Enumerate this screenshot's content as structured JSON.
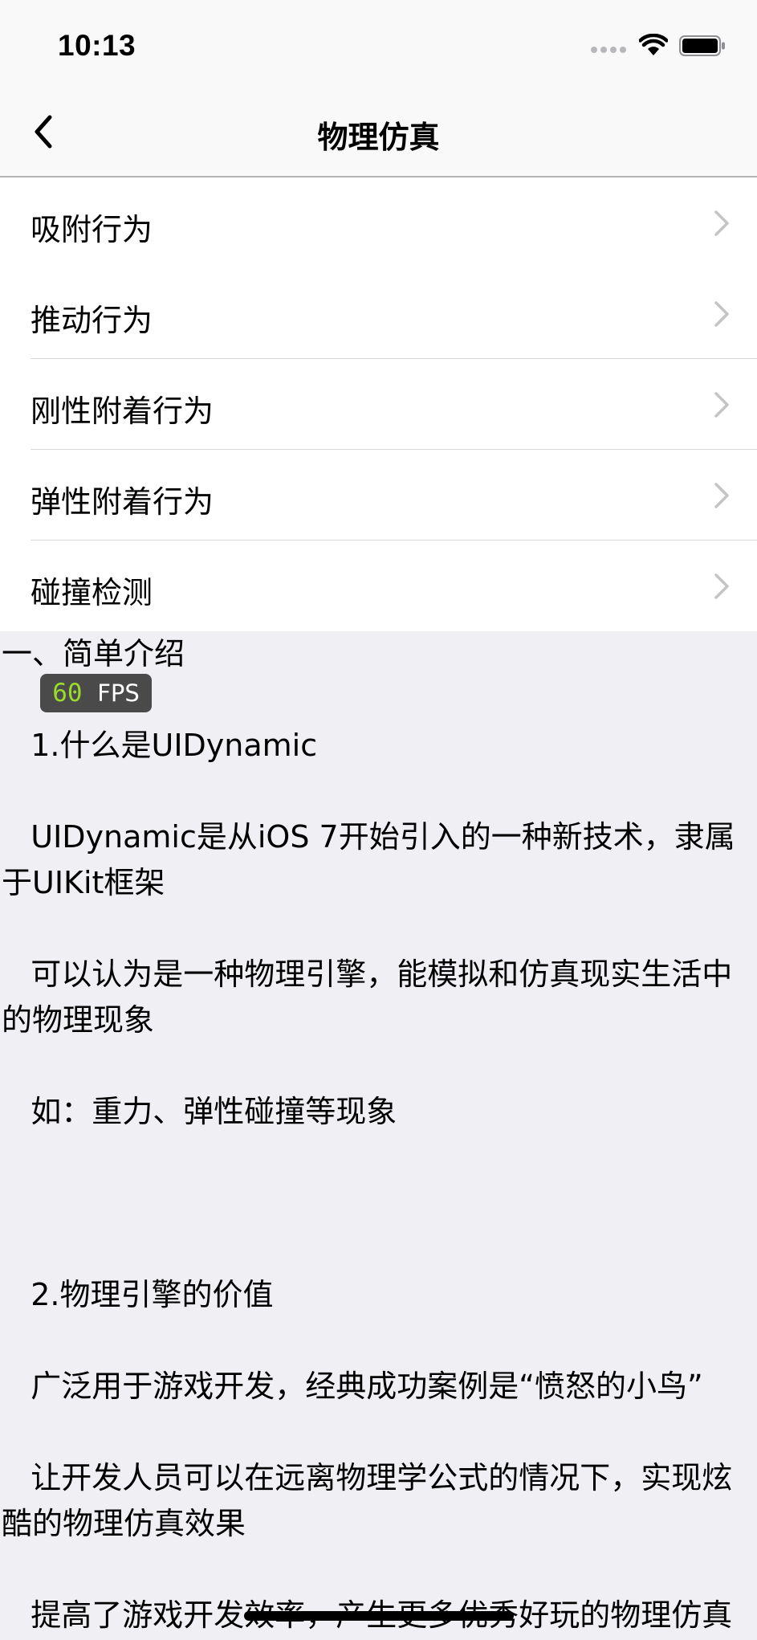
{
  "status_bar": {
    "time": "10:13"
  },
  "nav": {
    "title": "物理仿真"
  },
  "list": [
    {
      "label": "吸附行为"
    },
    {
      "label": "推动行为"
    },
    {
      "label": "刚性附着行为"
    },
    {
      "label": "弹性附着行为"
    },
    {
      "label": "碰撞检测"
    }
  ],
  "fps": {
    "value": "60",
    "unit": "FPS"
  },
  "text_view": {
    "content": "一、简单介绍\n\n   1.什么是UIDynamic\n\n   UIDynamic是从iOS 7开始引入的一种新技术，隶属于UIKit框架\n\n   可以认为是一种物理引擎，能模拟和仿真现实生活中的物理现象\n\n   如：重力、弹性碰撞等现象\n\n\n\n   2.物理引擎的价值\n\n   广泛用于游戏开发，经典成功案例是“愤怒的小鸟”\n\n   让开发人员可以在远离物理学公式的情况下，实现炫酷的物理仿真效果\n\n   提高了游戏开发效率，产生更多优秀好玩的物理仿真游戏"
  },
  "colors": {
    "background": "#efeff4",
    "fps_number": "#9bdc2b",
    "separator": "#d6d6da",
    "chevron": "#c4c4c7"
  }
}
